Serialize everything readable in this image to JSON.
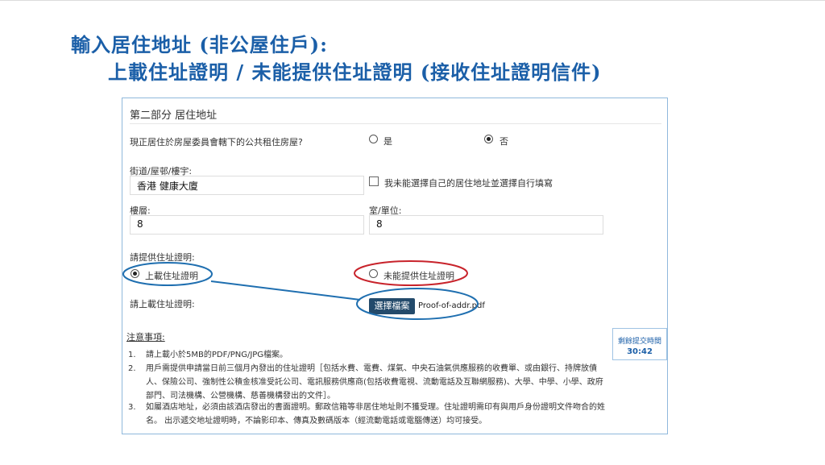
{
  "slide": {
    "title_line1": "輸入居住地址 (非公屋住戶):",
    "title_line2": "上載住址證明 / 未能提供住址證明 (接收住址證明信件)"
  },
  "section": {
    "title": "第二部分 居住地址",
    "public_housing_question": "現正居住於房屋委員會轄下的公共租住房屋?",
    "opt_yes": "是",
    "opt_no": "否",
    "street_label": "街道/屋邨/樓宇:",
    "street_value": "香港 健康大廈",
    "manual_checkbox_label": "我未能選擇自己的居住地址並選擇自行填寫",
    "floor_label": "樓層:",
    "floor_value": "8",
    "unit_label": "室/單位:",
    "unit_value": "8",
    "proof_question": "請提供住址證明:",
    "opt_upload": "上載住址證明",
    "opt_cannot": "未能提供住址證明",
    "upload_label": "請上載住址證明:",
    "choose_file_button": "選擇檔案",
    "file_name": "Proof-of-addr.pdf"
  },
  "notes": {
    "title": "注意事項:",
    "items": [
      {
        "num": "1.",
        "text": "請上載小於5MB的PDF/PNG/JPG檔案。"
      },
      {
        "num": "2.",
        "text": "用戶需提供申請當日前三個月內發出的住址證明［包括水費、電費、煤氣、中央石油氣供應服務的收費單、或由銀行、持牌放債人、保險公司、強制性公積金核准受託公司、電訊服務供應商(包括收費電視、流動電話及互聯網服務)、大學、中學、小學、政府部門、司法機構、公營機構、慈善機構發出的文件］。"
      },
      {
        "num": "3.",
        "text": "如屬酒店地址，必須由該酒店發出的書面證明。郵政信箱等非居住地址則不獲受理。住址證明需印有與用戶身份證明文件吻合的姓名。 出示遞交地址證明時，不論影印本、傳真及數碼版本（經流動電話或電腦傳送）均可接受。"
      }
    ]
  },
  "timer": {
    "label": "剩餘提交時間",
    "value": "30:42"
  },
  "colors": {
    "title_blue": "#1b5fa8",
    "annotation_blue": "#1f6fb0",
    "annotation_red": "#c8232b",
    "button_navy": "#234a6b"
  }
}
